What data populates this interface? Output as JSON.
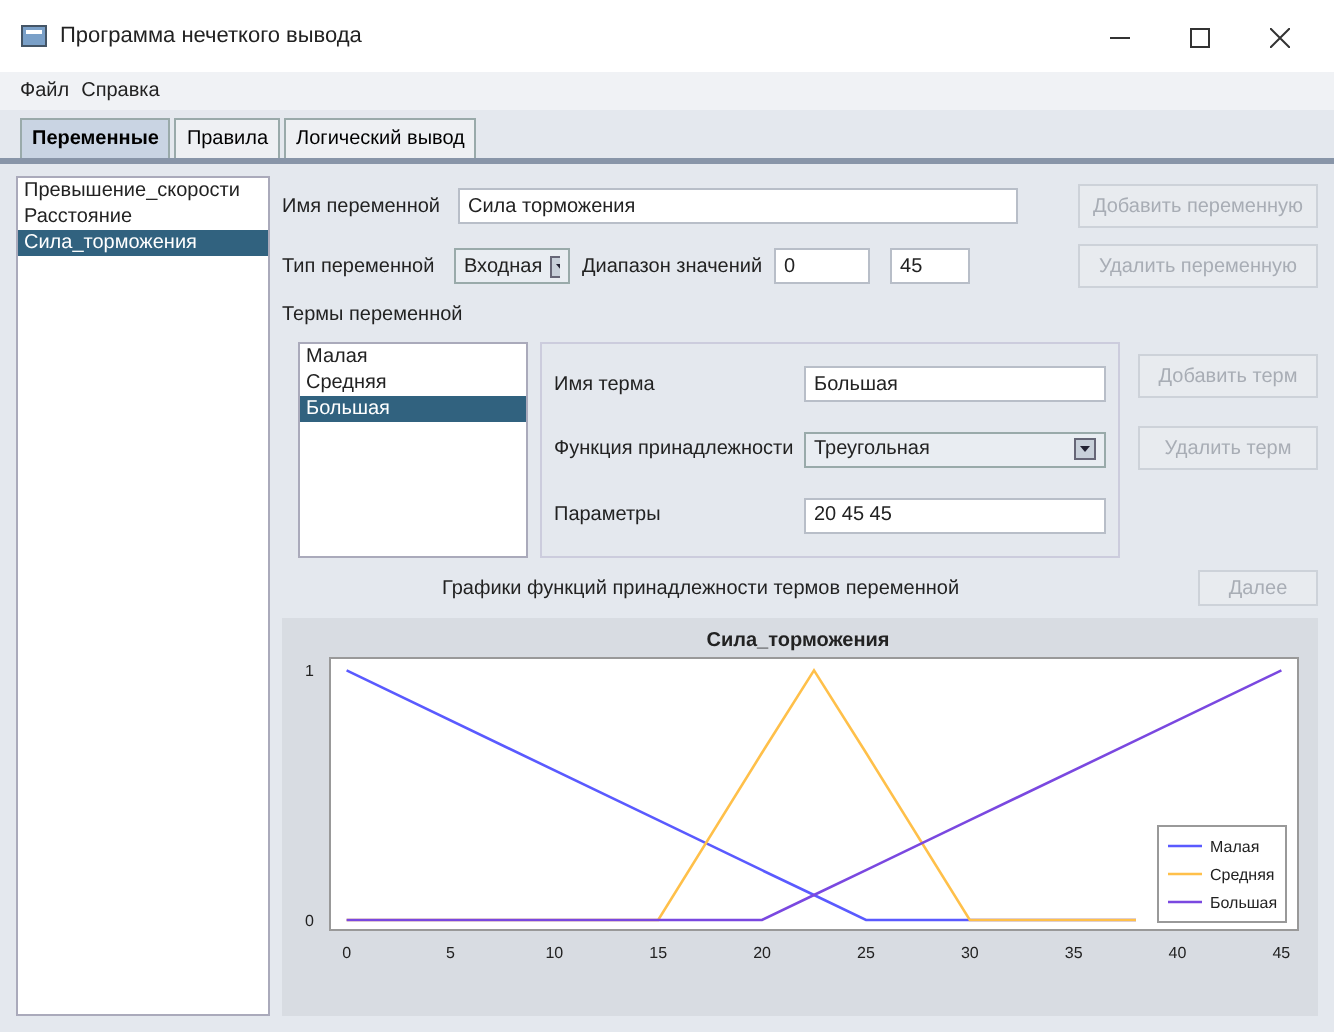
{
  "window": {
    "title": "Программа нечеткого вывода"
  },
  "menu": [
    "Файл",
    "Справка"
  ],
  "tabs": [
    {
      "label": "Переменные",
      "selected": true
    },
    {
      "label": "Правила",
      "selected": false
    },
    {
      "label": "Логический вывод",
      "selected": false
    }
  ],
  "variables": [
    {
      "label": "Превышение_скорости",
      "selected": false
    },
    {
      "label": "Расстояние",
      "selected": false
    },
    {
      "label": "Сила_торможения",
      "selected": true
    }
  ],
  "variable_name": {
    "label": "Имя переменной",
    "value": "Сила торможения"
  },
  "variable_type": {
    "label": "Тип переменной",
    "value": "Входная"
  },
  "range": {
    "label": "Диапазон значений",
    "from": "0",
    "to": "45"
  },
  "variable_buttons": [
    {
      "label": "Добавить переменную",
      "disabled": true
    },
    {
      "label": "Удалить переменную",
      "disabled": true
    }
  ],
  "terms_label": "Термы переменной",
  "terms": [
    {
      "label": "Малая",
      "selected": false
    },
    {
      "label": "Средняя",
      "selected": false
    },
    {
      "label": "Большая",
      "selected": true
    }
  ],
  "term_name": {
    "label": "Имя терма",
    "value": "Большая"
  },
  "membership_function": {
    "label": "Функция принадлежности",
    "value": "Треугольная"
  },
  "parameters": {
    "label": "Параметры",
    "value": "20 45 45"
  },
  "term_buttons": [
    {
      "label": "Добавить терм",
      "disabled": true
    },
    {
      "label": "Удалить терм",
      "disabled": true
    }
  ],
  "next_button": {
    "label": "Далее",
    "disabled": true
  },
  "chart_caption": "Графики функций принадлежности термов переменной",
  "chart_data": {
    "type": "line",
    "title": "Сила_торможения",
    "x": [
      0,
      15,
      20,
      22.5,
      25,
      30,
      38,
      45
    ],
    "series": [
      {
        "name": "Малая",
        "color": "#5a5aff",
        "values": [
          1,
          0.4,
          0.2,
          0.1,
          0,
          0,
          0,
          null
        ]
      },
      {
        "name": "Средняя",
        "color": "#ffc04a",
        "values": [
          0,
          0,
          0.67,
          1,
          0.67,
          0,
          0,
          null
        ]
      },
      {
        "name": "Большая",
        "color": "#7a48e0",
        "values": [
          0,
          0,
          0,
          0.1,
          0.2,
          0.4,
          0.72,
          1
        ]
      }
    ],
    "xlim": [
      -0.8,
      45.8
    ],
    "ylim": [
      -0.04,
      1.05
    ],
    "legend": true,
    "xticks": [
      0,
      5,
      10,
      15,
      20,
      25,
      30,
      35,
      40,
      45
    ],
    "yticks": [
      0,
      1
    ]
  }
}
